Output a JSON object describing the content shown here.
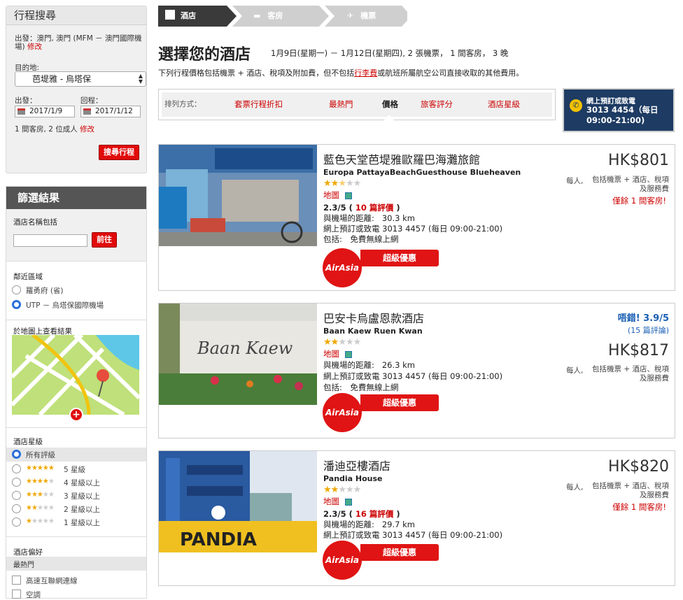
{
  "search": {
    "title": "行程搜尋",
    "from_label": "出發：",
    "from_value": "澳門, 澳門 (MFM － 澳門國際機場)",
    "edit": "修改",
    "dest_label": "目的地:",
    "dest_value": "芭堤雅 - 烏塔保",
    "depart_label": "出發：",
    "return_label": "回程：",
    "depart_date": "2017/1/9",
    "return_date": "2017/1/12",
    "guests": "1 間客房, 2 位成人",
    "guests_edit": "修改",
    "button": "搜尋行程"
  },
  "filter": {
    "title": "篩選結果",
    "name_label": "酒店名稱包括",
    "name_placeholder": "",
    "go": "前往",
    "area_label": "鄰近區域",
    "areas": [
      "羅勇府 (省)",
      "UTP － 烏塔保國際機場"
    ],
    "map_label": "於地圖上查看結果",
    "star_label": "酒店星級",
    "star_all": "所有評級",
    "star_options": [
      "5 星級",
      "4 星級以上",
      "3 星級以上",
      "2 星級以上",
      "1 星級以上"
    ],
    "pref_label": "酒店偏好",
    "pref_sub": "最熱門",
    "prefs": [
      "高速互聯網連線",
      "空調"
    ]
  },
  "steps": [
    "酒店",
    "客房",
    "機票"
  ],
  "header": {
    "title": "選擇您的酒店",
    "subtitle": "1月9日(星期一) － 1月12日(星期四), 2 張機票， 1 間客房， 3 晚",
    "note_a": "下列行程價格包括機票 + 酒店、稅項及附加費，但不包括",
    "note_link": "行李費",
    "note_b": "或航班所屬航空公司直接收取的其他費用。"
  },
  "sort": {
    "label": "排列方式：",
    "items": [
      "套票行程折扣",
      "最熱門",
      "價格",
      "旅客評分",
      "酒店星級"
    ],
    "active": "價格"
  },
  "phone": {
    "line1": "網上預訂或致電",
    "line2": "3013 4454（每日",
    "line3": "09:00-21:00)"
  },
  "hotels": [
    {
      "name": "藍色天堂芭堤雅歐羅巴海灘旅館",
      "ename": "Europa PattayaBeachGuesthouse Blueheaven",
      "rating": 2.5,
      "map": "地圖",
      "score": "2.3/5",
      "reviews": "10 篇評價",
      "distance_label": "與機場的距離:",
      "distance": "30.3 km",
      "booking": "網上預訂或致電 3013 4457 (每日 09:00-21:00)",
      "includes": "包括:　免費無線上網",
      "price": "HK$801",
      "per": "每人,",
      "incl": "包括機票 + 酒店、稅項及服務費",
      "left": "僅餘 1 間客房!",
      "deal": "超級優惠",
      "air": "AirAsia"
    },
    {
      "name": "巴安卡烏盧恩款酒店",
      "ename": "Baan Kaew Ruen Kwan",
      "rating": 2,
      "map": "地圖",
      "distance_label": "與機場的距離:",
      "distance": "26.3 km",
      "booking": "網上預訂或致電 3013 4457 (每日 09:00-21:00)",
      "includes": "包括:　免費無線上網",
      "badge": "唔錯! 3.9/5",
      "badge_reviews": "(15 篇評論)",
      "price": "HK$817",
      "per": "每人,",
      "incl": "包括機票 + 酒店、稅項及服務費",
      "deal": "超級優惠",
      "air": "AirAsia"
    },
    {
      "name": "潘迪亞樓酒店",
      "ename": "Pandia House",
      "rating": 2,
      "map": "地圖",
      "score": "2.3/5",
      "reviews": "16 篇評價",
      "distance_label": "與機場的距離:",
      "distance": "29.7 km",
      "booking": "網上預訂或致電 3013 4457 (每日 09:00-21:00)",
      "price": "HK$820",
      "per": "每人,",
      "incl": "包括機票 + 酒店、稅項及服務費",
      "left": "僅餘 1 間客房!",
      "deal": "超級優惠",
      "air": "AirAsia"
    }
  ],
  "colors": {
    "accent": "#e10a0a",
    "link": "#cc0000",
    "navy": "#1d3b63",
    "star": "#f0a800",
    "badge": "#1a5fb4"
  }
}
